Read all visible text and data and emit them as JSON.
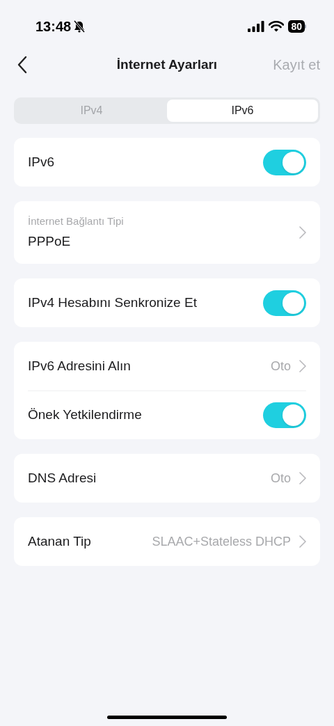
{
  "status_bar": {
    "time": "13:48",
    "battery": "80"
  },
  "nav": {
    "title": "İnternet Ayarları",
    "action": "Kayıt et"
  },
  "tabs": [
    {
      "label": "IPv4",
      "selected": false
    },
    {
      "label": "IPv6",
      "selected": true
    }
  ],
  "groups": [
    {
      "rows": [
        {
          "kind": "toggle",
          "label": "IPv6",
          "on": true
        }
      ]
    },
    {
      "rows": [
        {
          "kind": "picker",
          "caption": "İnternet Bağlantı Tipi",
          "label": "PPPoE"
        }
      ]
    },
    {
      "rows": [
        {
          "kind": "toggle",
          "label": "IPv4 Hesabını Senkronize Et",
          "on": true
        }
      ]
    },
    {
      "rows": [
        {
          "kind": "nav",
          "label": "IPv6 Adresini Alın",
          "value": "Oto"
        },
        {
          "kind": "toggle",
          "label": "Önek Yetkilendirme",
          "on": true
        }
      ]
    },
    {
      "rows": [
        {
          "kind": "nav",
          "label": "DNS Adresi",
          "value": "Oto"
        }
      ]
    },
    {
      "rows": [
        {
          "kind": "nav",
          "label": "Atanan Tip",
          "value": "SLAAC+Stateless DHCP"
        }
      ]
    }
  ]
}
